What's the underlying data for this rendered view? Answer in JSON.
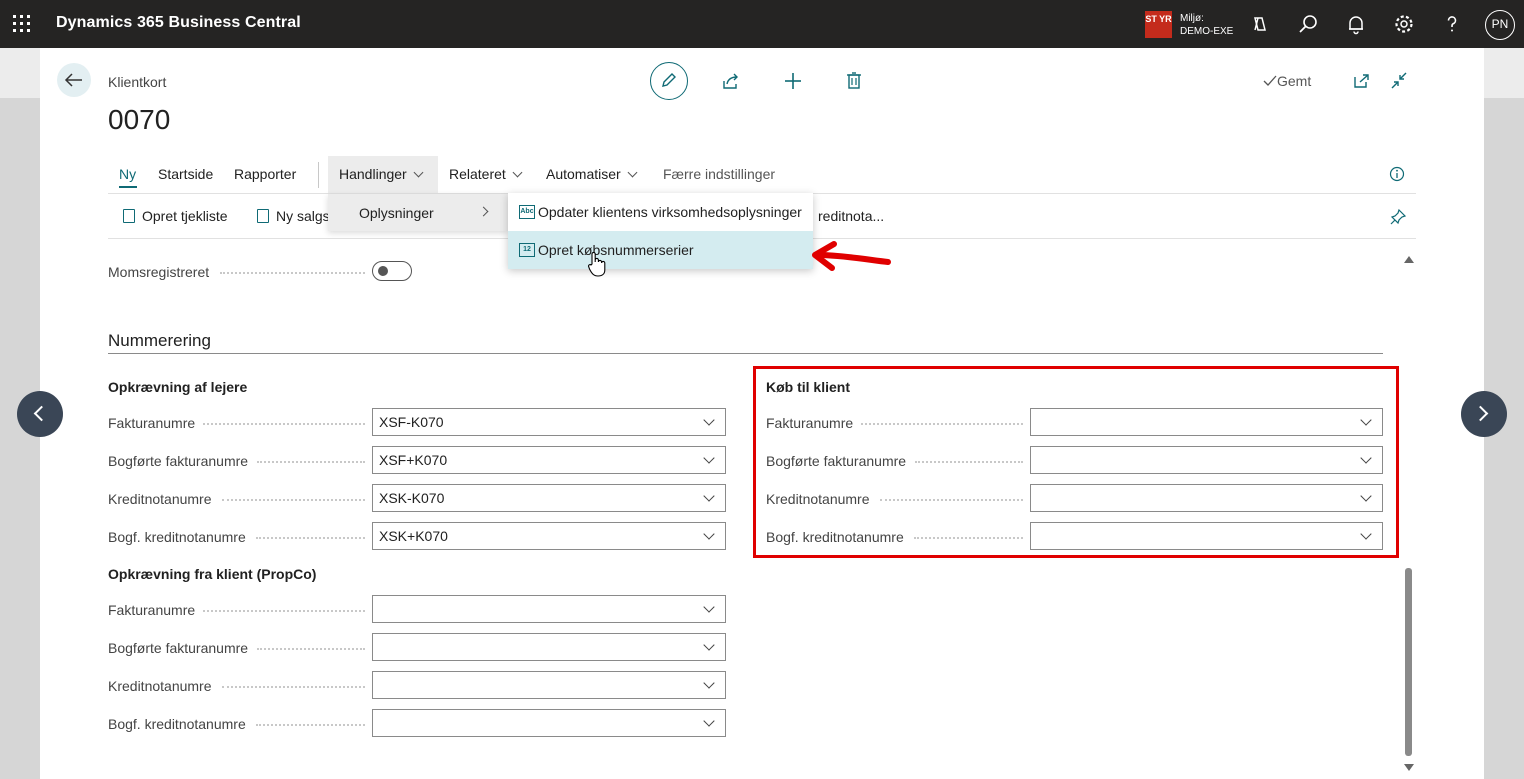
{
  "topbar": {
    "app_title": "Dynamics 365 Business Central",
    "env_badge": "ST YR",
    "env_label_line1": "Miljø:",
    "env_label_line2": "DEMO-EXE",
    "avatar_initials": "PN"
  },
  "page": {
    "breadcrumb": "Klientkort",
    "title": "0070",
    "saved_status": "Gemt"
  },
  "tabs": [
    {
      "label": "Ny"
    },
    {
      "label": "Startside"
    },
    {
      "label": "Rapporter"
    },
    {
      "label": "Handlinger"
    },
    {
      "label": "Relateret"
    },
    {
      "label": "Automatiser"
    },
    {
      "label": "Færre indstillinger"
    }
  ],
  "actions": {
    "item1": "Opret tjekliste",
    "item2": "Ny salgs",
    "item3": "reditnota..."
  },
  "menu1": {
    "item": "Oplysninger"
  },
  "menu2": {
    "items": [
      {
        "label": "Opdater klientens virksomhedsoplysninger"
      },
      {
        "label": "Opret købsnummerserier"
      }
    ]
  },
  "form": {
    "moms_label": "Momsregistreret",
    "section_title": "Nummerering",
    "group_left1": {
      "title": "Opkrævning af lejere",
      "fields": [
        {
          "label": "Fakturanumre",
          "value": "XSF-K070"
        },
        {
          "label": "Bogførte fakturanumre",
          "value": "XSF+K070"
        },
        {
          "label": "Kreditnotanumre",
          "value": "XSK-K070"
        },
        {
          "label": "Bogf. kreditnotanumre",
          "value": "XSK+K070"
        }
      ]
    },
    "group_left2": {
      "title": "Opkrævning fra klient (PropCo)",
      "fields": [
        {
          "label": "Fakturanumre",
          "value": ""
        },
        {
          "label": "Bogførte fakturanumre",
          "value": ""
        },
        {
          "label": "Kreditnotanumre",
          "value": ""
        },
        {
          "label": "Bogf. kreditnotanumre",
          "value": ""
        }
      ]
    },
    "group_right": {
      "title": "Køb til klient",
      "fields": [
        {
          "label": "Fakturanumre",
          "value": ""
        },
        {
          "label": "Bogførte fakturanumre",
          "value": ""
        },
        {
          "label": "Kreditnotanumre",
          "value": ""
        },
        {
          "label": "Bogf. kreditnotanumre",
          "value": ""
        }
      ]
    }
  },
  "colors": {
    "accent": "#0f6a75",
    "annotation_red": "#e00000",
    "topbar_bg": "#252423"
  }
}
